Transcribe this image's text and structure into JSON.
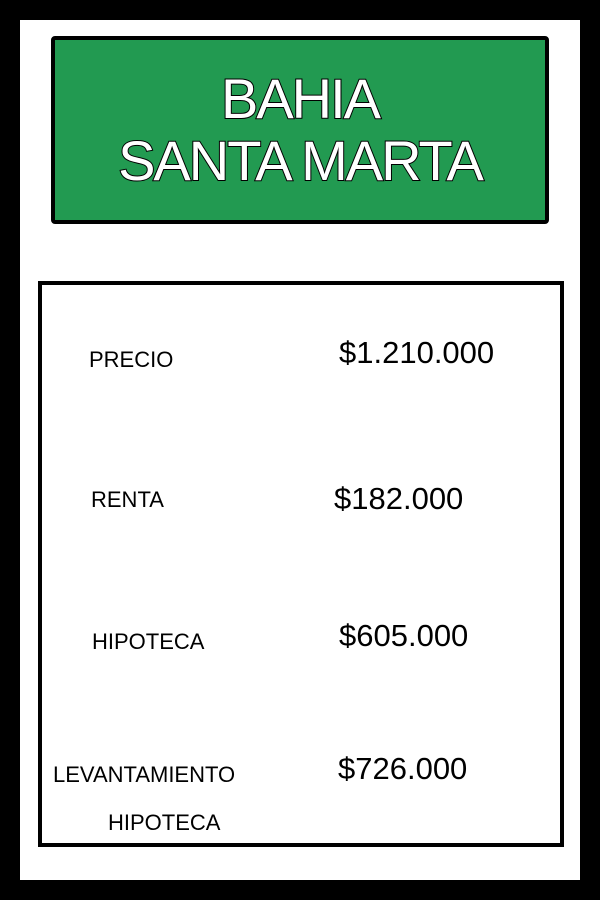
{
  "title": {
    "line1": "BAHIA",
    "line2": "SANTA MARTA"
  },
  "colors": {
    "title_background": "#229a51",
    "title_text": "#ffffff",
    "border": "#000000"
  },
  "rows": {
    "precio": {
      "label": "PRECIO",
      "value": "$1.210.000"
    },
    "renta": {
      "label": "RENTA",
      "value": "$182.000"
    },
    "hipoteca": {
      "label": "HIPOTECA",
      "value": "$605.000"
    },
    "levantamiento": {
      "label_line1": "LEVANTAMIENTO",
      "label_line2": "HIPOTECA",
      "value": "$726.000"
    }
  }
}
